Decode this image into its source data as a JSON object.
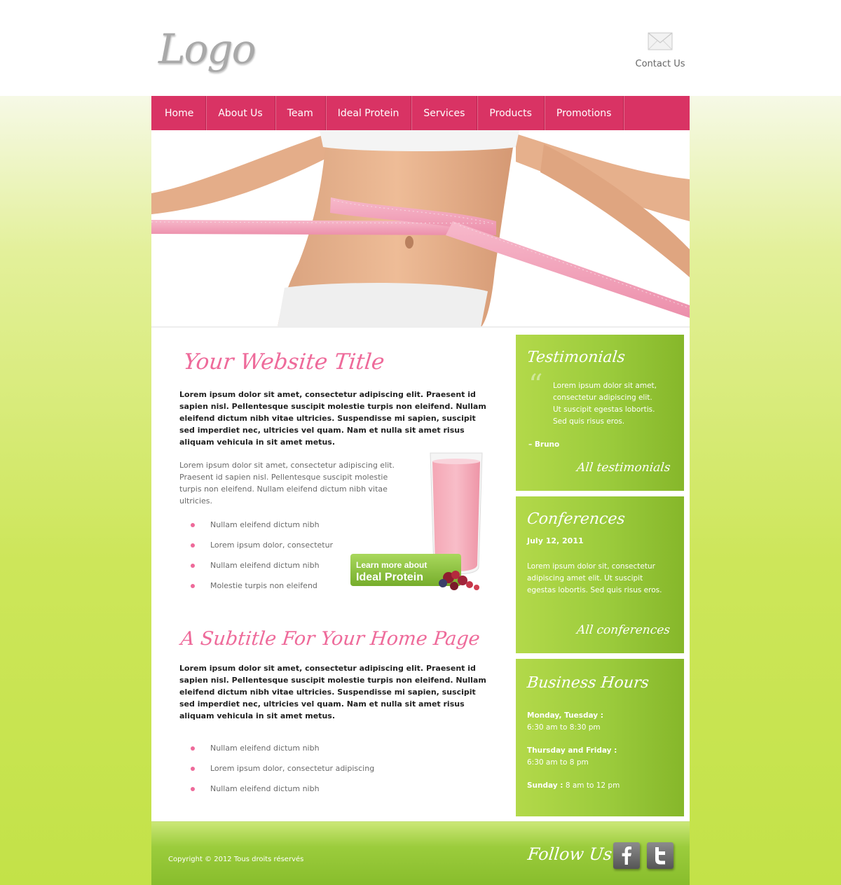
{
  "header": {
    "logo": "Logo",
    "contact_label": "Contact Us",
    "contact_icon": "envelope-icon"
  },
  "nav": {
    "items": [
      "Home",
      "About Us",
      "Team",
      "Ideal Protein",
      "Services",
      "Products",
      "Promotions"
    ]
  },
  "hero": {
    "image": "hero-waist-measuring-tape"
  },
  "main": {
    "title": "Your Website Title",
    "lead": "Lorem ipsum dolor sit amet, consectetur adipiscing elit. Praesent id sapien nisl. Pellentesque suscipit molestie turpis non eleifend. Nullam eleifend dictum nibh vitae ultricies. Suspendisse mi sapien, suscipit sed imperdiet nec, ultricies vel quam. Nam et nulla sit amet risus aliquam vehicula in sit amet metus.",
    "para": "Lorem ipsum dolor sit amet, consectetur adipiscing elit. Praesent id sapien nisl. Pellentesque suscipit molestie turpis non eleifend. Nullam eleifend dictum nibh vitae ultricies.",
    "bullets": [
      "Nullam eleifend dictum nibh",
      "Lorem ipsum dolor, consectetur",
      "Nullam eleifend dictum nibh",
      "Molestie turpis non eleifend"
    ],
    "promo": {
      "line1": "Learn more about",
      "line2": "Ideal Protein"
    },
    "subtitle": "A Subtitle For Your Home Page",
    "lead2": "Lorem ipsum dolor sit amet, consectetur adipiscing elit. Praesent id sapien nisl. Pellentesque suscipit molestie turpis non eleifend. Nullam eleifend dictum nibh vitae ultricies. Suspendisse mi sapien, suscipit sed imperdiet nec, ultricies vel quam. Nam et nulla sit amet risus aliquam vehicula in sit amet metus.",
    "bullets2": [
      "Nullam eleifend dictum nibh",
      "Lorem ipsum dolor, consectetur adipiscing",
      "Nullam eleifend dictum nibh"
    ]
  },
  "sidebar": {
    "testimonials": {
      "title": "Testimonials",
      "quote_lines": [
        "Lorem ipsum dolor sit amet,",
        "consectetur adipiscing elit.",
        "Ut suscipit egestas lobortis.",
        "Sed quis risus eros."
      ],
      "author": "– Bruno",
      "link": "All testimonials"
    },
    "conferences": {
      "title": "Conferences",
      "date": "July 12, 2011",
      "text_lines": [
        "Lorem ipsum dolor sit, consectetur",
        "adipiscing amet elit. Ut suscipit",
        "egestas lobortis. Sed quis risus eros."
      ],
      "link": "All conferences"
    },
    "hours": {
      "title": "Business Hours",
      "entries": [
        {
          "day": "Monday, Tuesday :",
          "time": "6:30 am to 8:30 pm"
        },
        {
          "day": "Thursday and Friday :",
          "time": "6:30 am to 8 pm"
        },
        {
          "day": "Sunday :",
          "time": " 8 am to 12 pm"
        }
      ]
    }
  },
  "footer": {
    "copyright": "Copyright © 2012 Tous droits réservés",
    "follow": "Follow Us",
    "social": [
      "facebook-icon",
      "twitter-icon"
    ]
  },
  "colors": {
    "accent_pink": "#d93364",
    "title_pink": "#ee6a9a",
    "green": "#9bcb3c"
  }
}
